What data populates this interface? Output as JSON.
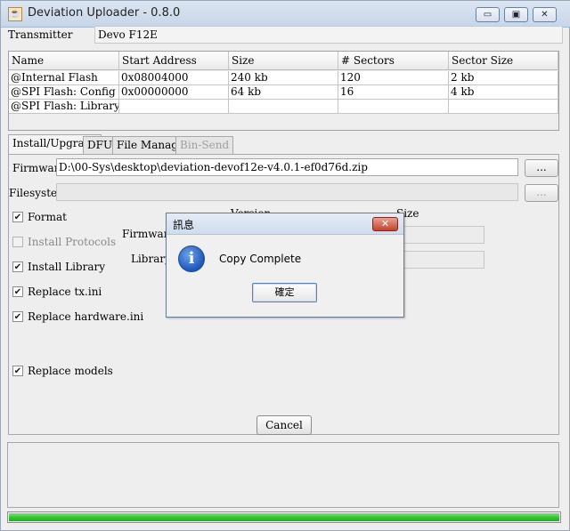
{
  "window": {
    "title": "Deviation Uploader - 0.8.0",
    "controls": {
      "minimize": "▭",
      "maximize": "▣",
      "close": "✕"
    }
  },
  "transmitter": {
    "label": "Transmitter",
    "value": "Devo F12E"
  },
  "table": {
    "headers": [
      "Name",
      "Start Address",
      "Size",
      "# Sectors",
      "Sector Size"
    ],
    "rows": [
      [
        "@Internal Flash",
        "0x08004000",
        "240 kb",
        "120",
        "2 kb"
      ],
      [
        "@SPI Flash: Config",
        "0x00000000",
        "64 kb",
        "16",
        "4 kb"
      ],
      [
        "@SPI Flash: Library",
        "",
        "",
        "",
        ""
      ]
    ]
  },
  "tabs": [
    {
      "label": "Install/Upgrade",
      "state": "active"
    },
    {
      "label": "DFU",
      "state": "normal"
    },
    {
      "label": "File Manager",
      "state": "normal"
    },
    {
      "label": "Bin-Send",
      "state": "disabled"
    }
  ],
  "install": {
    "firmware_label": "Firmware",
    "firmware_path": "D:\\00-Sys\\desktop\\deviation-devof12e-v4.0.1-ef0d76d.zip",
    "browse_label": "...",
    "filesystem_label": "Filesystem",
    "filesystem_path": "",
    "checkboxes": [
      {
        "label": "Format",
        "checked": true,
        "enabled": true
      },
      {
        "label": "Install Protocols",
        "checked": false,
        "enabled": false
      },
      {
        "label": "Install Library",
        "checked": true,
        "enabled": true
      },
      {
        "label": "Replace tx.ini",
        "checked": true,
        "enabled": true
      },
      {
        "label": "Replace hardware.ini",
        "checked": true,
        "enabled": true
      },
      {
        "label": "Replace models",
        "checked": true,
        "enabled": true
      }
    ],
    "version_header": "Version",
    "size_header": "Size",
    "row_firmware_label": "Firmware",
    "row_library_label": "Library",
    "cancel_label": "Cancel"
  },
  "progress": {
    "value": 1.0,
    "color": "#2fc62f"
  },
  "dialog": {
    "title": "訊息",
    "close_glyph": "✕",
    "icon": "info-icon",
    "icon_glyph": "i",
    "message": "Copy Complete",
    "ok_label": "確定"
  },
  "check_glyph": "✔"
}
